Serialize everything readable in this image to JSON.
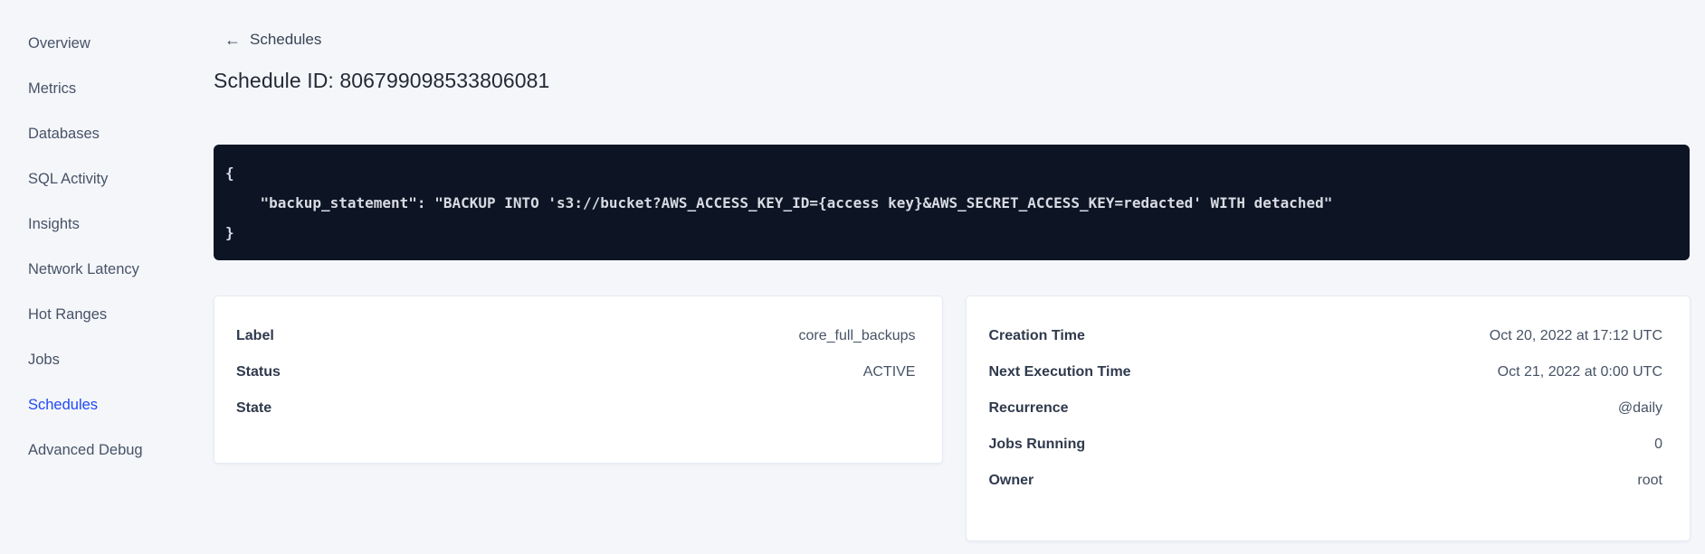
{
  "sidebar": {
    "items": [
      {
        "label": "Overview",
        "active": false
      },
      {
        "label": "Metrics",
        "active": false
      },
      {
        "label": "Databases",
        "active": false
      },
      {
        "label": "SQL Activity",
        "active": false
      },
      {
        "label": "Insights",
        "active": false
      },
      {
        "label": "Network Latency",
        "active": false
      },
      {
        "label": "Hot Ranges",
        "active": false
      },
      {
        "label": "Jobs",
        "active": false
      },
      {
        "label": "Schedules",
        "active": true
      },
      {
        "label": "Advanced Debug",
        "active": false
      }
    ]
  },
  "page": {
    "back_icon": "←",
    "back_label": "Schedules",
    "title": "Schedule ID: 806799098533806081",
    "code": {
      "lines": [
        "{",
        "    \"backup_statement\": \"BACKUP INTO 's3://bucket?AWS_ACCESS_KEY_ID={access key}&AWS_SECRET_ACCESS_KEY=redacted' WITH detached\"",
        "}"
      ]
    },
    "details_card": {
      "rows": [
        {
          "label": "Label",
          "value": "core_full_backups"
        },
        {
          "label": "Status",
          "value": "ACTIVE"
        },
        {
          "label": "State",
          "value": ""
        }
      ]
    },
    "schedule_card": {
      "rows": [
        {
          "label": "Creation Time",
          "value": "Oct 20, 2022 at 17:12 UTC"
        },
        {
          "label": "Next Execution Time",
          "value": "Oct 21, 2022 at 0:00 UTC"
        },
        {
          "label": "Recurrence",
          "value": "@daily"
        },
        {
          "label": "Jobs Running",
          "value": "0"
        },
        {
          "label": "Owner",
          "value": "root"
        }
      ]
    }
  },
  "colors": {
    "page_background": "#f4f6fa",
    "sidebar_text": "#475366",
    "active_link_blue": "#2149f5",
    "heading_text": "#242a35",
    "code_background": "#0d1525",
    "code_text": "#d7dbe2",
    "card_background": "#ffffff",
    "card_border": "#e7ecf3"
  }
}
